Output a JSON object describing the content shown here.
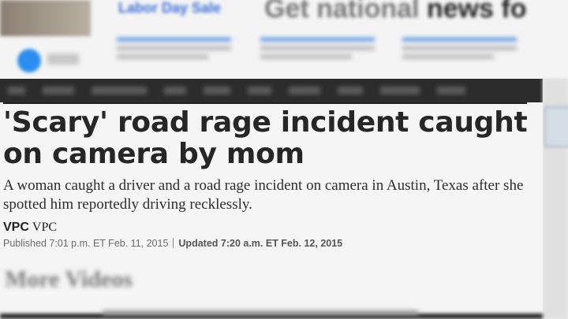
{
  "header": {
    "promo_link": "Labor Day Sale",
    "promo_headline_pre": "Get national ",
    "promo_headline_bold": "news fo"
  },
  "article": {
    "headline": "'Scary' road rage incident caught on camera by mom",
    "summary": "A woman caught a driver and a road rage incident on camera in Austin, Texas after she spotted him reportedly driving recklessly.",
    "byline_bold": "VPC",
    "byline_plain": "VPC",
    "published": "Published 7:01 p.m. ET Feb. 11, 2015",
    "updated": "Updated 7:20 a.m. ET Feb. 12, 2015"
  },
  "more": {
    "title": "More Videos"
  },
  "colors": {
    "nav": "#2c2c2c",
    "accent": "#3d86e6"
  }
}
